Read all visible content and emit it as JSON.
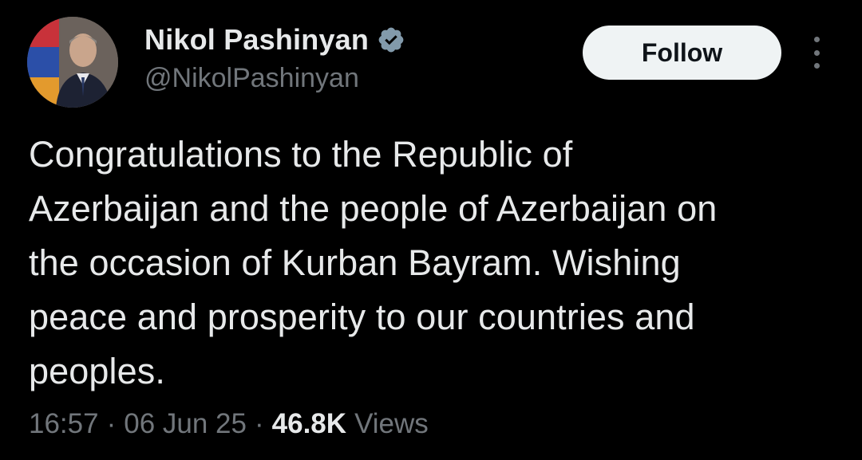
{
  "author": {
    "display_name": "Nikol Pashinyan",
    "handle": "@NikolPashinyan",
    "verified_icon": "verified-badge",
    "avatar_icon": "profile-photo"
  },
  "actions": {
    "follow_label": "Follow",
    "more_icon": "more-vertical-icon"
  },
  "tweet": {
    "text": "Congratulations to the Republic of\nAzerbaijan and the people of Azerbaijan on\nthe occasion of Kurban Bayram. Wishing\npeace and prosperity to our countries and\npeoples."
  },
  "meta": {
    "time": "16:57",
    "separator": "·",
    "date": "06 Jun 25",
    "views_count": "46.8K",
    "views_label": "Views"
  },
  "colors": {
    "background": "#000000",
    "primary_text": "#e7e9ea",
    "secondary_text": "#71767b",
    "follow_bg": "#eff3f4",
    "verified": "#829aab"
  }
}
